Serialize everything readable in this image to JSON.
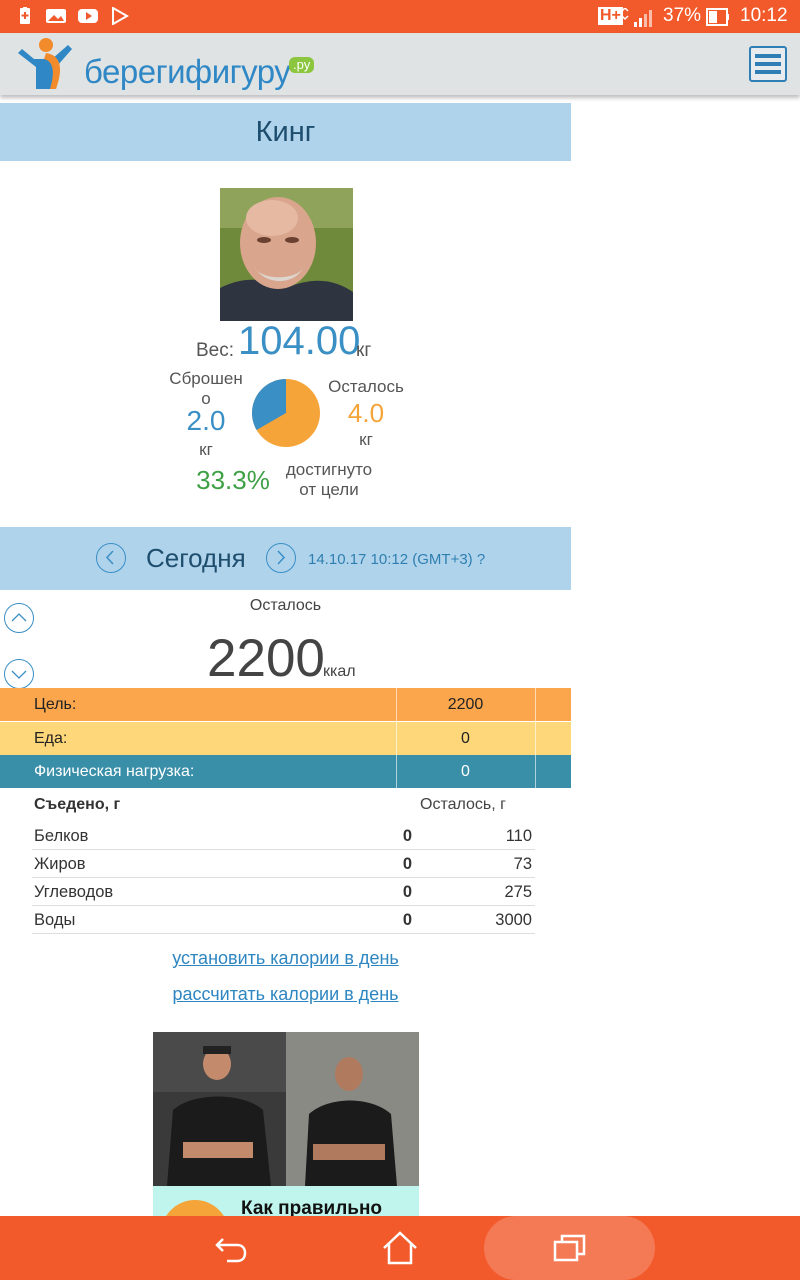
{
  "status_bar": {
    "network": "H+",
    "battery": "37%",
    "time": "10:12",
    "icons": [
      "battery-saver-icon",
      "gallery-icon",
      "youtube-icon",
      "play-store-icon"
    ]
  },
  "header": {
    "logo_text": "берегифигуру",
    "logo_suffix": ".ру",
    "menu_icon": "hamburger-menu-icon"
  },
  "profile": {
    "name": "Кинг",
    "weight_label": "Вес:",
    "weight_value": "104.00",
    "weight_unit": "кг",
    "lost_label_1": "Сброшен",
    "lost_label_2": "о",
    "lost_value": "2.0",
    "lost_unit": "кг",
    "remaining_label": "Осталось",
    "remaining_value": "4.0",
    "remaining_unit": "кг",
    "progress_percent": "33.3%",
    "progress_fraction": 0.333,
    "progress_label_1": "достигнуто",
    "progress_label_2": "от цели",
    "colors": {
      "lost": "#3a8fc5",
      "remaining": "#f5a43a",
      "progress": "#3fa046"
    }
  },
  "today": {
    "label": "Сегодня",
    "datetime": "14.10.17 10:12 (GMT+3)",
    "help": "?",
    "remaining_label": "Осталось",
    "kcal_value": "2200",
    "kcal_unit": "ккал"
  },
  "goal_table": [
    {
      "label": "Цель:",
      "value": "2200",
      "color": "#fba64c"
    },
    {
      "label": "Еда:",
      "value": "0",
      "color": "#fdd779"
    },
    {
      "label": "Физическая нагрузка:",
      "value": "0",
      "color": "#3a8fa8"
    }
  ],
  "macros": {
    "eaten_header": "Съедено, г",
    "left_header": "Осталось, г",
    "rows": [
      {
        "name": "Белков",
        "eaten": "0",
        "left": "110"
      },
      {
        "name": "Жиров",
        "eaten": "0",
        "left": "73"
      },
      {
        "name": "Углеводов",
        "eaten": "0",
        "left": "275"
      },
      {
        "name": "Воды",
        "eaten": "0",
        "left": "3000"
      }
    ]
  },
  "links": {
    "set_calories": "установить калории в день",
    "calc_calories": "рассчитать калории в день"
  },
  "promo": {
    "caption": "Как правильно"
  },
  "nav": {
    "back_icon": "back-icon",
    "home_icon": "home-icon",
    "recents_icon": "recent-apps-icon"
  }
}
